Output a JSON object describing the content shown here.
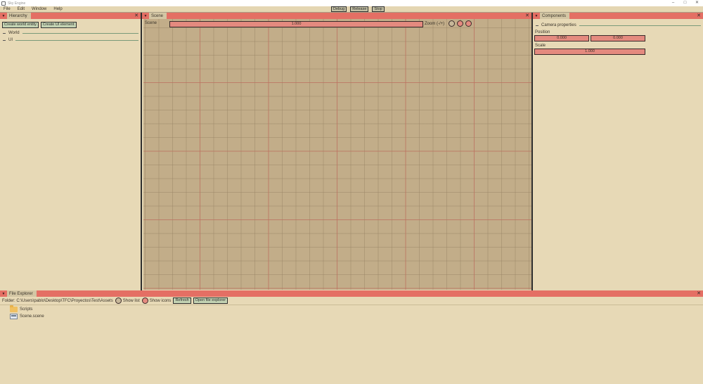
{
  "window": {
    "title": "Sky Engine",
    "controls": {
      "minimize": "–",
      "maximize": "□",
      "close": "✕"
    }
  },
  "menubar": {
    "items": [
      "File",
      "Edit",
      "Window",
      "Help"
    ],
    "run_buttons": [
      "Debug",
      "Release",
      "Stop"
    ]
  },
  "hierarchy": {
    "tab": "Hierarchy",
    "close": "✕",
    "create_world_entity": "Create world entity",
    "create_ui_element": "Create UI element",
    "tree": [
      "World",
      "UI"
    ]
  },
  "scene": {
    "tab": "Scene",
    "close": "✕",
    "label": "Scene",
    "zoom_value": "1.000",
    "zoom_label": "Zoom (-/+)",
    "zoom_buttons": [
      "zoom-neutral",
      "zoom-out",
      "zoom-in"
    ]
  },
  "components": {
    "tab": "Components",
    "close": "✕",
    "section": "Camera properties",
    "position_label": "Position",
    "position_x": "0.000",
    "position_y": "0.000",
    "scale_label": "Scale",
    "scale_value": "1.000"
  },
  "file_explorer": {
    "tab": "File Explorer",
    "close": "✕",
    "folder_path": "Folder: C:\\Users\\pablo\\Desktop\\TFC\\Proyectos\\Test\\Assets",
    "show_list": "Show list",
    "show_icons": "Show icons",
    "refresh": "Refresh",
    "open_file_explorer": "Open file explorer",
    "items": [
      {
        "name": "Scripts",
        "icon": "folder-icon"
      },
      {
        "name": "Scene.scene",
        "icon": "file-icon"
      }
    ]
  },
  "colors": {
    "background": "#e7d9b6",
    "header_accent": "#e46f64",
    "field_fill": "#e48a7f",
    "button_fill": "#c3d3b3",
    "scene_bg": "#c2ad89",
    "grid_major": "#c46e5f"
  }
}
